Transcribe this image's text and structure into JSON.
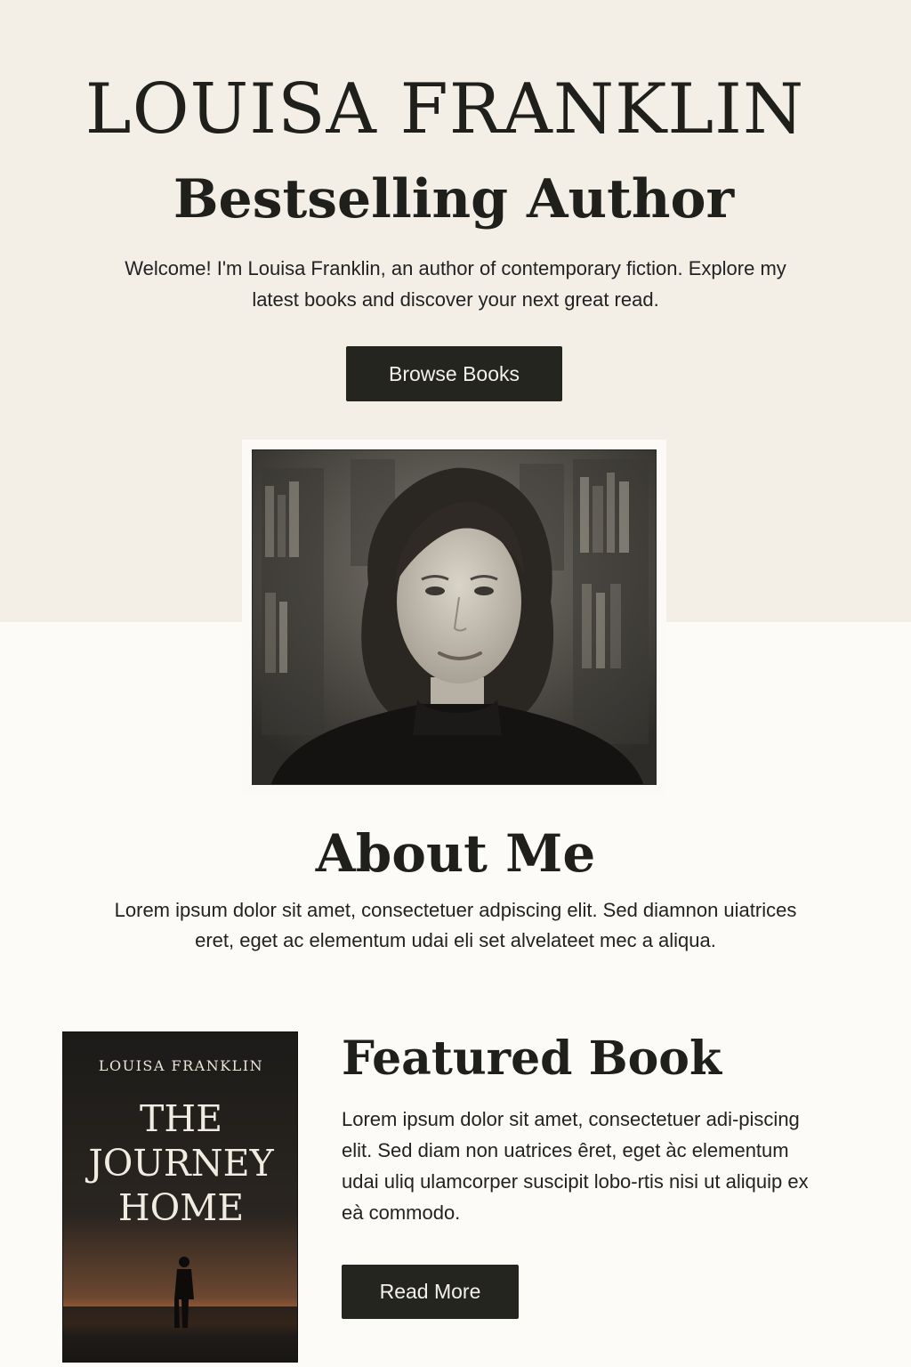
{
  "hero": {
    "name": "LOUISA FRANKLIN",
    "subtitle": "Bestselling Author",
    "intro": "Welcome! I'm Louisa Franklin, an author of contemporary fiction. Explore my latest books and discover your next great read.",
    "browse_label": "Browse Books"
  },
  "about": {
    "title": "About Me",
    "text": "Lorem ipsum dolor sit amet, consectetuer adpiscing elit. Sed diamnon uiatrices eret, eget ac elementum udai eli set alvelateet mec a aliqua."
  },
  "featured": {
    "title": "Featured Book",
    "text": "Lorem ipsum dolor sit amet, consectetuer adi-piscing elit. Sed diam non uatrices êret, eget àc elementum udai uliq ulamcorper suscipit lobo-rtis nisi ut aliquip ex eà commodo.",
    "read_more_label": "Read More",
    "cover": {
      "author": "LOUISA FRANKLIN",
      "title_lines": [
        "THE",
        "JOURNEY",
        "HOME"
      ]
    }
  },
  "colors": {
    "hero_background": "#f3efe7",
    "page_background": "#fcfbf7",
    "button": "#252520",
    "button_text": "#f4f1ea",
    "text": "#1f1f1c"
  }
}
